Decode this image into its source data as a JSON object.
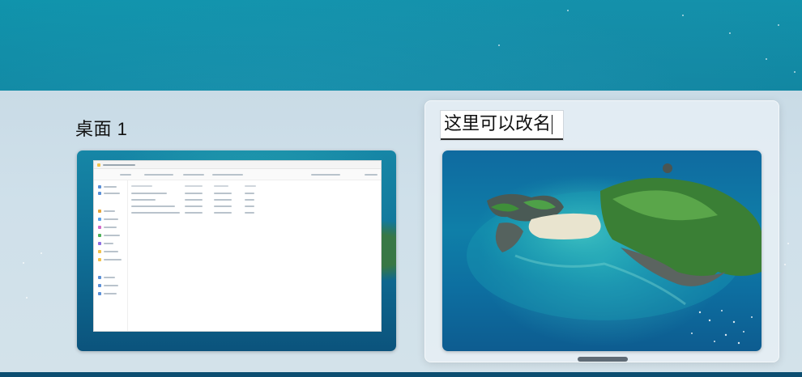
{
  "desktops": [
    {
      "name": "桌面 1",
      "state": "inactive",
      "thumbnail": "file-explorer-window-on-wallpaper"
    },
    {
      "name": "这里可以改名",
      "state": "renaming",
      "thumbnail": "island-wallpaper"
    }
  ],
  "colors": {
    "panel": "#cfe0ea",
    "selected_card": "#e6eff5",
    "scroll_pill": "#5f6b75"
  }
}
